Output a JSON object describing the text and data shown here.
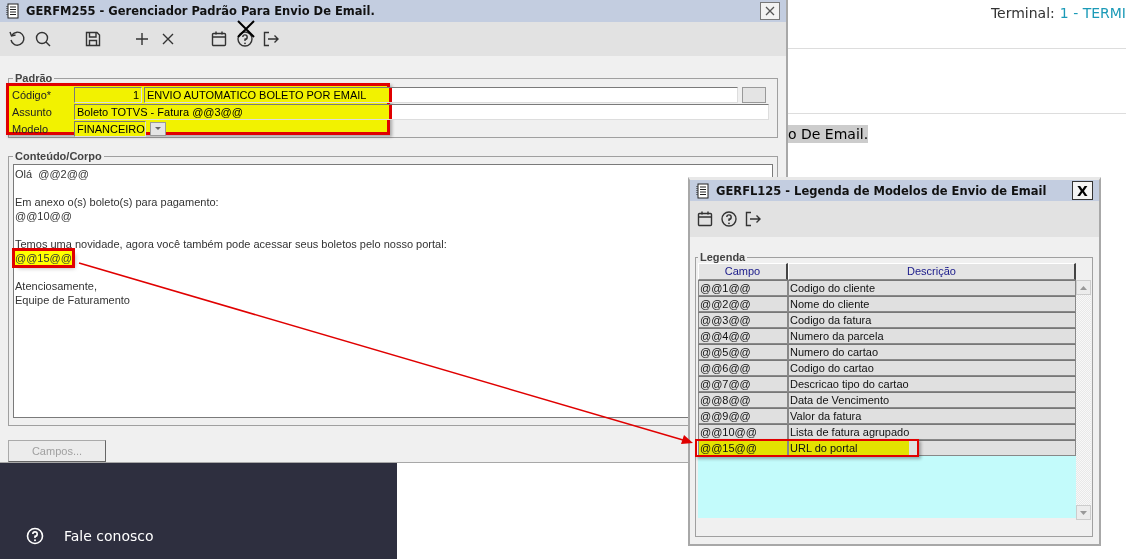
{
  "portal": {
    "terminal_label": "Terminal:",
    "terminal_value": "1 - TERMI",
    "selected_text": "o De Email.",
    "sidebar_items": [
      {
        "label": "Fale conosco"
      }
    ]
  },
  "main_window": {
    "title": "GERFM255 - Gerenciador Padrão Para Envio De Email.",
    "padrao": {
      "title": "Padrão",
      "highlighted": true,
      "codigo_label": "Código*",
      "codigo_value": "1",
      "codigo_description": "ENVIO AUTOMATICO BOLETO POR EMAIL",
      "assunto_label": "Assunto",
      "assunto_value": "Boleto TOTVS - Fatura @@3@@",
      "modelo_label": "Modelo",
      "modelo_value": "FINANCEIRO"
    },
    "corpo": {
      "title": "Conteúdo/Corpo",
      "paragraphs": [
        {
          "lines": [
            {
              "text": "Olá  @@2@@",
              "highlighted": false
            }
          ]
        },
        {
          "lines": [
            {
              "text": "Em anexo o(s) boleto(s) para pagamento:",
              "highlighted": false
            },
            {
              "text": "@@10@@",
              "highlighted": false
            }
          ]
        },
        {
          "lines": [
            {
              "text": "Temos uma novidade, agora você também pode acessar seus boletos pelo nosso portal:",
              "highlighted": false
            },
            {
              "text": "@@15@@",
              "highlighted": true
            }
          ]
        },
        {
          "lines": [
            {
              "text": "Atenciosamente,",
              "highlighted": false
            },
            {
              "text": "Equipe de Faturamento",
              "highlighted": false
            }
          ]
        }
      ]
    },
    "buttons": [
      {
        "label": "Campos...",
        "disabled": true
      }
    ]
  },
  "legend_window": {
    "title": "GERFL125 - Legenda de Modelos de Envio de Email",
    "close_label": "X",
    "group_title": "Legenda",
    "columns": [
      "Campo",
      "Descrição"
    ],
    "rows": [
      {
        "campo": "@@1@@",
        "descricao": "Codigo do cliente",
        "highlighted": false
      },
      {
        "campo": "@@2@@",
        "descricao": "Nome do cliente",
        "highlighted": false
      },
      {
        "campo": "@@3@@",
        "descricao": "Codigo da fatura",
        "highlighted": false
      },
      {
        "campo": "@@4@@",
        "descricao": "Numero da parcela",
        "highlighted": false
      },
      {
        "campo": "@@5@@",
        "descricao": "Numero do cartao",
        "highlighted": false
      },
      {
        "campo": "@@6@@",
        "descricao": "Codigo do cartao",
        "highlighted": false
      },
      {
        "campo": "@@7@@",
        "descricao": "Descricao tipo do cartao",
        "highlighted": false
      },
      {
        "campo": "@@8@@",
        "descricao": "Data de Vencimento",
        "highlighted": false
      },
      {
        "campo": "@@9@@",
        "descricao": "Valor da fatura",
        "highlighted": false
      },
      {
        "campo": "@@10@@",
        "descricao": "Lista de fatura agrupado",
        "highlighted": false
      },
      {
        "campo": "@@15@@",
        "descricao": "URL do portal",
        "highlighted": true
      }
    ]
  }
}
